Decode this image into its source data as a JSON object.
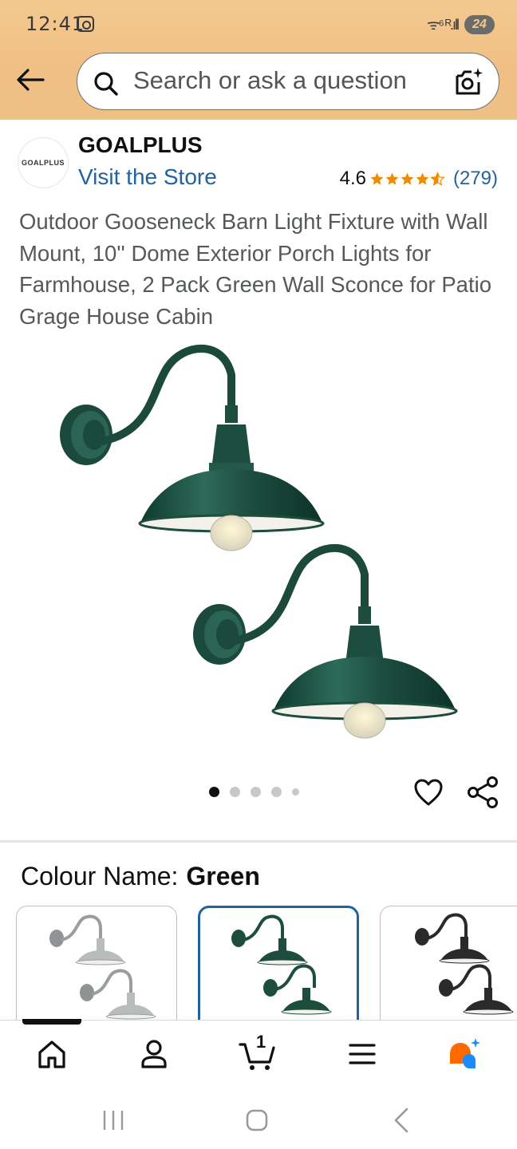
{
  "status_bar": {
    "time": "12:41",
    "signal": "ᯤ⁶ ᴿ.ıll",
    "battery": "24"
  },
  "header": {
    "search_placeholder": "Search or ask a question"
  },
  "brand": {
    "logo_text": "GOALPLUS",
    "name": "GOALPLUS",
    "visit_store": "Visit the Store",
    "rating": "4.6",
    "rating_stars": 4.6,
    "review_count": "(279)"
  },
  "product": {
    "title": "Outdoor Gooseneck Barn Light Fixture with Wall Mount, 10'' Dome Exterior Porch Lights for Farmhouse, 2 Pack Green Wall Sconce for Patio Grage House Cabin",
    "image_count": 5,
    "active_image_index": 0
  },
  "colour": {
    "label": "Colour Name:",
    "value": "Green",
    "swatches": [
      {
        "name": "Silver",
        "color": "#b9bcbd",
        "selected": false
      },
      {
        "name": "Green",
        "color": "#1d4d3f",
        "selected": true
      },
      {
        "name": "Black",
        "color": "#2a2a2a",
        "selected": false
      }
    ]
  },
  "bottom_nav": {
    "items": [
      "home",
      "account",
      "cart",
      "menu",
      "rufus"
    ],
    "cart_count": "1",
    "active": "home"
  },
  "colors": {
    "link": "#2162a1",
    "star": "#f08b00",
    "lamp_green": "#1d4d3f",
    "header_gradient": "#f3c98f"
  }
}
